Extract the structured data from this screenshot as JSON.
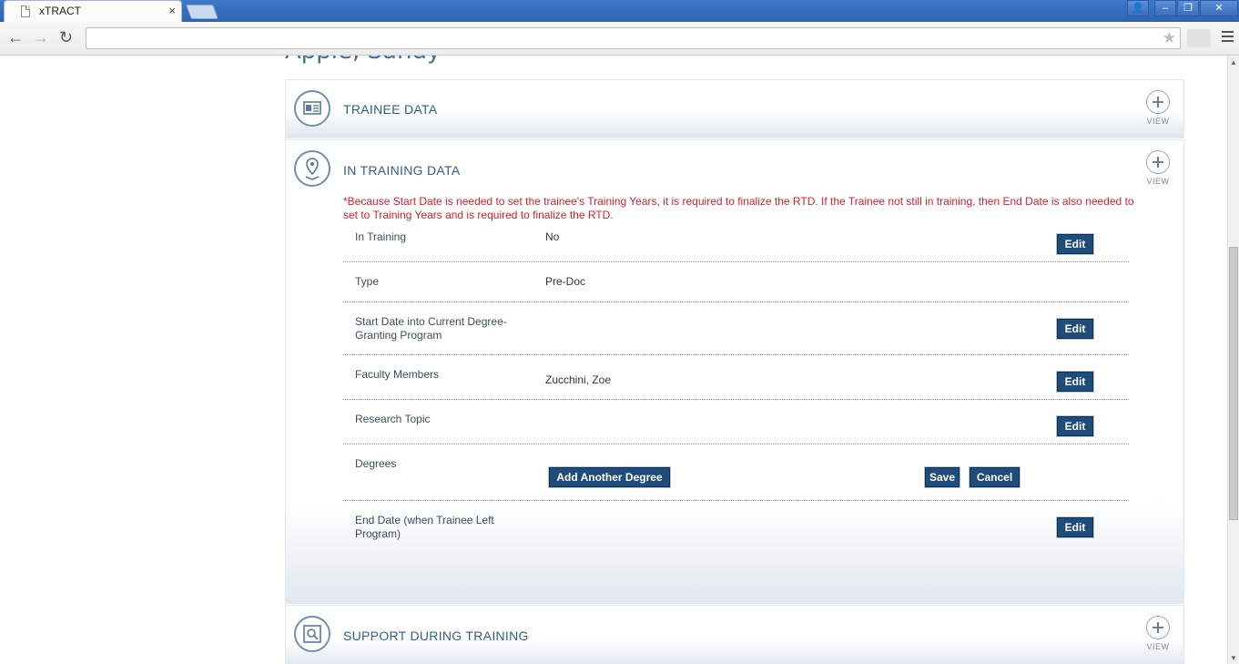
{
  "browser": {
    "tab_title": "xTRACT",
    "tab_close": "×",
    "url": "",
    "window_controls": {
      "user": "👤",
      "minimize": "–",
      "restore": "❐",
      "close": "✕"
    },
    "nav": {
      "back": "←",
      "forward": "→",
      "reload": "↻",
      "star": "★"
    }
  },
  "page": {
    "person_name": "Apple, Sandy",
    "view_label": "VIEW",
    "sections": {
      "trainee": {
        "title": "TRAINEE DATA",
        "icon": "id-card-icon"
      },
      "in_training": {
        "title": "IN TRAINING DATA",
        "icon": "map-pin-icon",
        "warning": "*Because Start Date is needed to set the trainee's Training Years, it is required to finalize the RTD. If the Trainee not still in training, then End Date is also needed to set to Training Years and is required to finalize the RTD.",
        "rows": [
          {
            "label": "In Training",
            "value": "No",
            "edit": "Edit"
          },
          {
            "label": "Type",
            "value": "Pre-Doc"
          },
          {
            "label": "Start Date into Current Degree-Granting Program",
            "value": "",
            "edit": "Edit"
          },
          {
            "label": "Faculty Members",
            "value": "Zucchini, Zoe",
            "edit": "Edit"
          },
          {
            "label": "Research Topic",
            "value": "",
            "edit": "Edit"
          },
          {
            "label": "Degrees",
            "add": "Add Another Degree",
            "save": "Save",
            "cancel": "Cancel"
          },
          {
            "label": "End Date (when Trainee Left Program)",
            "value": "",
            "edit": "Edit"
          }
        ]
      },
      "support": {
        "title": "SUPPORT DURING TRAINING",
        "icon": "magnifier-icon"
      }
    }
  },
  "colors": {
    "accent": "#1f4c7a",
    "title": "#2f5f88",
    "warning": "#d4202a"
  }
}
